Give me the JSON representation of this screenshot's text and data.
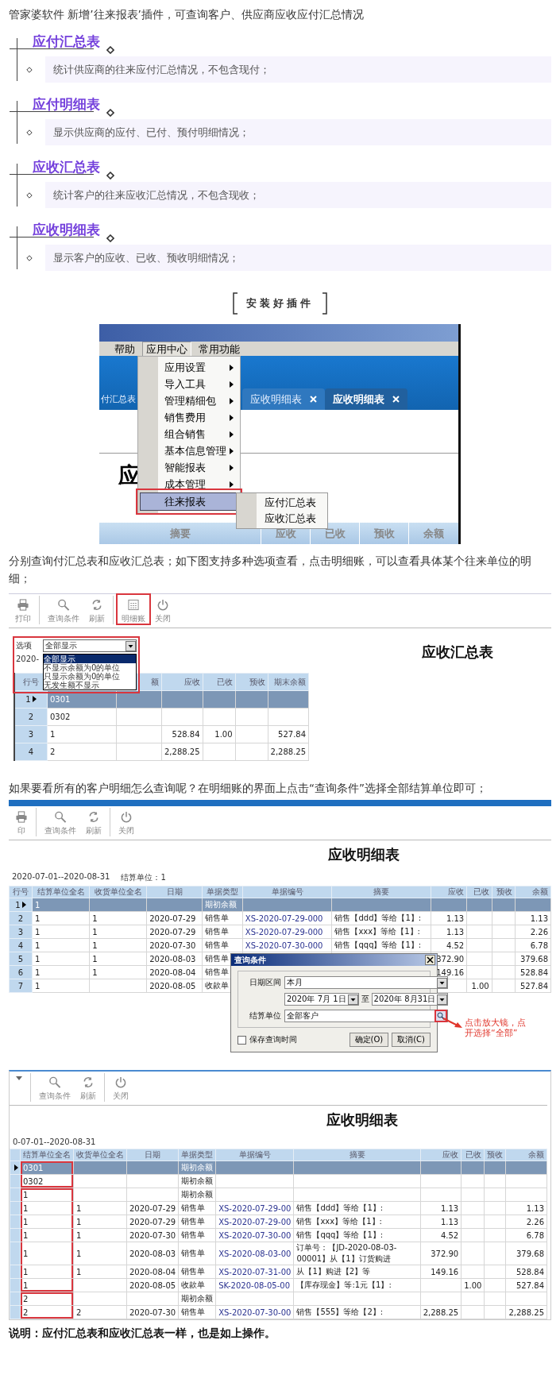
{
  "intro": "管家婆软件 新增’往来报表’插件，可查询客户、供应商应收应付汇总情况",
  "sections": [
    {
      "title": "应付汇总表",
      "text": "统计供应商的往来应付汇总情况，不包含现付；"
    },
    {
      "title": "应付明细表",
      "text": "显示供应商的应付、已付、预付明细情况；"
    },
    {
      "title": "应收汇总表",
      "text": "统计客户的往来应收汇总情况，不包含现收；"
    },
    {
      "title": "应收明细表",
      "text": "显示客户的应收、已收、预收明细情况；"
    }
  ],
  "install_heading": "安装好插件",
  "menu_screenshot": {
    "menubar": [
      {
        "label": "帮助",
        "selected": false
      },
      {
        "label": "应用中心",
        "selected": true
      },
      {
        "label": "常用功能",
        "selected": false
      }
    ],
    "tabs": [
      {
        "label": "付汇总表",
        "selected": false,
        "closable": false
      },
      {
        "label": "应收明细表",
        "selected": false,
        "closable": true
      },
      {
        "label": "应收明细表",
        "selected": true,
        "closable": true
      }
    ],
    "page_title": "应",
    "menu": [
      {
        "label": "应用设置",
        "submenu": true,
        "selected": false,
        "highlighted": false
      },
      {
        "label": "导入工具",
        "submenu": true,
        "selected": false,
        "highlighted": false
      },
      {
        "label": "管理精细包",
        "submenu": true,
        "selected": false,
        "highlighted": false
      },
      {
        "label": "销售费用",
        "submenu": true,
        "selected": false,
        "highlighted": false
      },
      {
        "label": "组合销售",
        "submenu": true,
        "selected": false,
        "highlighted": false
      },
      {
        "label": "基本信息管理",
        "submenu": true,
        "selected": false,
        "highlighted": false
      },
      {
        "label": "智能报表",
        "submenu": true,
        "selected": false,
        "highlighted": false
      },
      {
        "label": "成本管理",
        "submenu": true,
        "selected": false,
        "highlighted": false
      },
      {
        "label": "往来报表",
        "submenu": false,
        "selected": true,
        "highlighted": true
      }
    ],
    "submenu": [
      "应付汇总表",
      "应收汇总表"
    ],
    "columns": [
      "摘要",
      "应收",
      "已收",
      "预收",
      "余额"
    ]
  },
  "paragraph_1": "分别查询付汇总表和应收汇总表；如下图支持多种选项查看，点击明细账，可以查看具体某个往来单位的明细；",
  "summary_screenshot": {
    "toolbar": [
      {
        "kind": "print",
        "label": "打印",
        "highlighted": false
      },
      {
        "kind": "search",
        "label": "查询条件",
        "highlighted": false
      },
      {
        "kind": "refresh",
        "label": "刷新",
        "highlighted": false
      },
      {
        "kind": "detail",
        "label": "明细账",
        "highlighted": true
      },
      {
        "kind": "power",
        "label": "关闭",
        "highlighted": false
      }
    ],
    "title": "应收汇总表",
    "options": {
      "label": "选项",
      "value": "全部显示",
      "date_fragment": "2020-",
      "highlighted": true,
      "choices": [
        {
          "label": "全部显示",
          "selected": true
        },
        {
          "label": "不显示余额为0的单位",
          "selected": false
        },
        {
          "label": "只显示余额为0的单位",
          "selected": false
        },
        {
          "label": "无发生额不显示",
          "selected": false
        }
      ]
    },
    "columns": [
      {
        "label": "行号",
        "kind": "rowno"
      },
      {
        "kind": "text"
      },
      {
        "label": "额",
        "kind": "amount"
      },
      {
        "label": "应收",
        "kind": "amount"
      },
      {
        "label": "已收",
        "kind": "amount"
      },
      {
        "label": "预收",
        "kind": "amount"
      },
      {
        "label": "期末余额",
        "kind": "amount"
      }
    ],
    "rows": [
      {
        "selected": true,
        "cells": [
          "1",
          "0301",
          null,
          null,
          null,
          null,
          null
        ]
      },
      {
        "selected": false,
        "cells": [
          "2",
          "0302",
          null,
          null,
          null,
          null,
          null
        ]
      },
      {
        "selected": false,
        "cells": [
          "3",
          "1",
          null,
          "528.84",
          "1.00",
          null,
          "527.84"
        ]
      },
      {
        "selected": false,
        "cells": [
          "4",
          "2",
          null,
          "2,288.25",
          null,
          null,
          "2,288.25"
        ]
      }
    ]
  },
  "paragraph_2": "如果要看所有的客户明细怎么查询呢？在明细账的界面上点击“查询条件”选择全部结算单位即可；",
  "detail_screenshot": {
    "toolbar": [
      {
        "kind": "print",
        "label": "印",
        "highlighted": false
      },
      {
        "kind": "search",
        "label": "查询条件",
        "highlighted": false
      },
      {
        "kind": "refresh",
        "label": "刷新",
        "highlighted": false
      },
      {
        "kind": "power",
        "label": "关闭",
        "highlighted": false
      }
    ],
    "title": "应收明细表",
    "period": "2020-07-01--2020-08-31",
    "unit": "结算单位：1",
    "columns": [
      {
        "label": "行号",
        "kind": "rowno"
      },
      {
        "label": "结算单位全名",
        "kind": "text"
      },
      {
        "label": "收货单位全名",
        "kind": "text"
      },
      {
        "label": "日期",
        "kind": "text"
      },
      {
        "label": "单据类型",
        "kind": "text"
      },
      {
        "label": "单据编号",
        "kind": "code"
      },
      {
        "label": "摘要",
        "kind": "summary"
      },
      {
        "label": "应收",
        "kind": "amount"
      },
      {
        "label": "已收",
        "kind": "amount"
      },
      {
        "label": "预收",
        "kind": "amount"
      },
      {
        "label": "余额",
        "kind": "amount"
      }
    ],
    "rows": [
      {
        "selected": true,
        "cells": [
          "1",
          "1",
          null,
          null,
          "期初余额",
          null,
          null,
          null,
          null,
          null,
          null
        ]
      },
      {
        "selected": false,
        "cells": [
          "2",
          "1",
          "1",
          "2020-07-29",
          "销售单",
          "XS-2020-07-29-000",
          "销售【ddd】等给【1】:",
          "1.13",
          null,
          null,
          "1.13"
        ]
      },
      {
        "selected": false,
        "cells": [
          "3",
          "1",
          "1",
          "2020-07-29",
          "销售单",
          "XS-2020-07-29-000",
          "销售【xxx】等给【1】:",
          "1.13",
          null,
          null,
          "2.26"
        ]
      },
      {
        "selected": false,
        "cells": [
          "4",
          "1",
          "1",
          "2020-07-30",
          "销售单",
          "XS-2020-07-30-000",
          "销售【qqq】等给【1】:",
          "4.52",
          null,
          null,
          "6.78"
        ]
      },
      {
        "selected": false,
        "cells": [
          "5",
          "1",
          "1",
          "2020-08-03",
          "销售单",
          null,
          null,
          "372.90",
          null,
          null,
          "379.68"
        ]
      },
      {
        "selected": false,
        "cells": [
          "6",
          "1",
          "1",
          "2020-08-04",
          "销售单",
          null,
          null,
          "149.16",
          null,
          null,
          "528.84"
        ]
      },
      {
        "selected": false,
        "cells": [
          "7",
          "1",
          null,
          "2020-08-05",
          "收款单",
          null,
          null,
          null,
          "1.00",
          null,
          "527.84"
        ]
      }
    ],
    "dialog": {
      "title": "查询条件",
      "date_label": "日期区间",
      "date_range": "本月",
      "date_from": "2020年 7月 1日",
      "separator": "至",
      "date_to": "2020年 8月31日",
      "unit_label": "结算单位",
      "unit_value": "全部客户",
      "unit_button_highlighted": true,
      "save_label": "保存查询时间",
      "save_checked": false,
      "buttons": [
        "确定(O)",
        "取消(C)"
      ]
    },
    "annotation": "点击放大镜，点开选择“全部”"
  },
  "all_detail_screenshot": {
    "toolbar": [
      {
        "kind": "caret",
        "highlighted": false
      },
      {
        "kind": "search",
        "label": "查询条件",
        "highlighted": false
      },
      {
        "kind": "refresh",
        "label": "刷新",
        "highlighted": false
      },
      {
        "kind": "power",
        "label": "关闭",
        "highlighted": false
      }
    ],
    "title": "应收明细表",
    "period": "0-07-01--2020-08-31",
    "columns": [
      {
        "kind": "rowno"
      },
      {
        "label": "结算单位全名",
        "kind": "text"
      },
      {
        "label": "收货单位全名",
        "kind": "text"
      },
      {
        "label": "日期",
        "kind": "text"
      },
      {
        "label": "单据类型",
        "kind": "text"
      },
      {
        "label": "单据编号",
        "kind": "code"
      },
      {
        "label": "摘要",
        "kind": "summary"
      },
      {
        "label": "应收",
        "kind": "amount"
      },
      {
        "label": "已收",
        "kind": "amount"
      },
      {
        "label": "预收",
        "kind": "amount"
      },
      {
        "label": "余额",
        "kind": "amount"
      }
    ],
    "rows": [
      {
        "selected": true,
        "frame_start": true,
        "cells": [
          null,
          "0301",
          null,
          null,
          "期初余额",
          null,
          null,
          null,
          null,
          null,
          null
        ]
      },
      {
        "selected": false,
        "frame_start": false,
        "cells": [
          null,
          "0302",
          null,
          null,
          "期初余额",
          null,
          null,
          null,
          null,
          null,
          null
        ]
      },
      {
        "selected": false,
        "frame_start": true,
        "cells": [
          null,
          "1",
          null,
          null,
          "期初余额",
          null,
          null,
          null,
          null,
          null,
          null
        ]
      },
      {
        "selected": false,
        "frame_start": false,
        "cells": [
          null,
          "1",
          "1",
          "2020-07-29",
          "销售单",
          "XS-2020-07-29-00",
          "销售【ddd】等给【1】:",
          "1.13",
          null,
          null,
          "1.13"
        ]
      },
      {
        "selected": false,
        "frame_start": false,
        "cells": [
          null,
          "1",
          "1",
          "2020-07-29",
          "销售单",
          "XS-2020-07-29-00",
          "销售【xxx】等给【1】:",
          "1.13",
          null,
          null,
          "2.26"
        ]
      },
      {
        "selected": false,
        "frame_start": false,
        "cells": [
          null,
          "1",
          "1",
          "2020-07-30",
          "销售单",
          "XS-2020-07-30-00",
          "销售【qqq】等给【1】:",
          "4.52",
          null,
          null,
          "6.78"
        ]
      },
      {
        "selected": false,
        "frame_start": false,
        "cells": [
          null,
          "1",
          "1",
          "2020-08-03",
          "销售单",
          "XS-2020-08-03-00",
          "订单号：【JD-2020-08-03-00001】从【1】订货购进",
          "372.90",
          null,
          null,
          "379.68"
        ]
      },
      {
        "selected": false,
        "frame_start": false,
        "cells": [
          null,
          "1",
          "1",
          "2020-08-04",
          "销售单",
          "XS-2020-07-31-00",
          "从【1】购进【2】等",
          "149.16",
          null,
          null,
          "528.84"
        ]
      },
      {
        "selected": false,
        "frame_start": false,
        "cells": [
          null,
          "1",
          null,
          "2020-08-05",
          "收款单",
          "SK-2020-08-05-00",
          "【库存现金】等:1元【1】:",
          null,
          "1.00",
          null,
          "527.84"
        ]
      },
      {
        "selected": false,
        "frame_start": true,
        "cells": [
          null,
          "2",
          null,
          null,
          "期初余额",
          null,
          null,
          null,
          null,
          null,
          null
        ]
      },
      {
        "selected": false,
        "frame_start": false,
        "cells": [
          null,
          "2",
          "2",
          "2020-07-30",
          "销售单",
          "XS-2020-07-30-00",
          "销售【555】等给【2】:",
          "2,288.25",
          null,
          null,
          "2,288.25"
        ]
      }
    ]
  },
  "note": "说明：应付汇总表和应收汇总表一样，也是如上操作。"
}
